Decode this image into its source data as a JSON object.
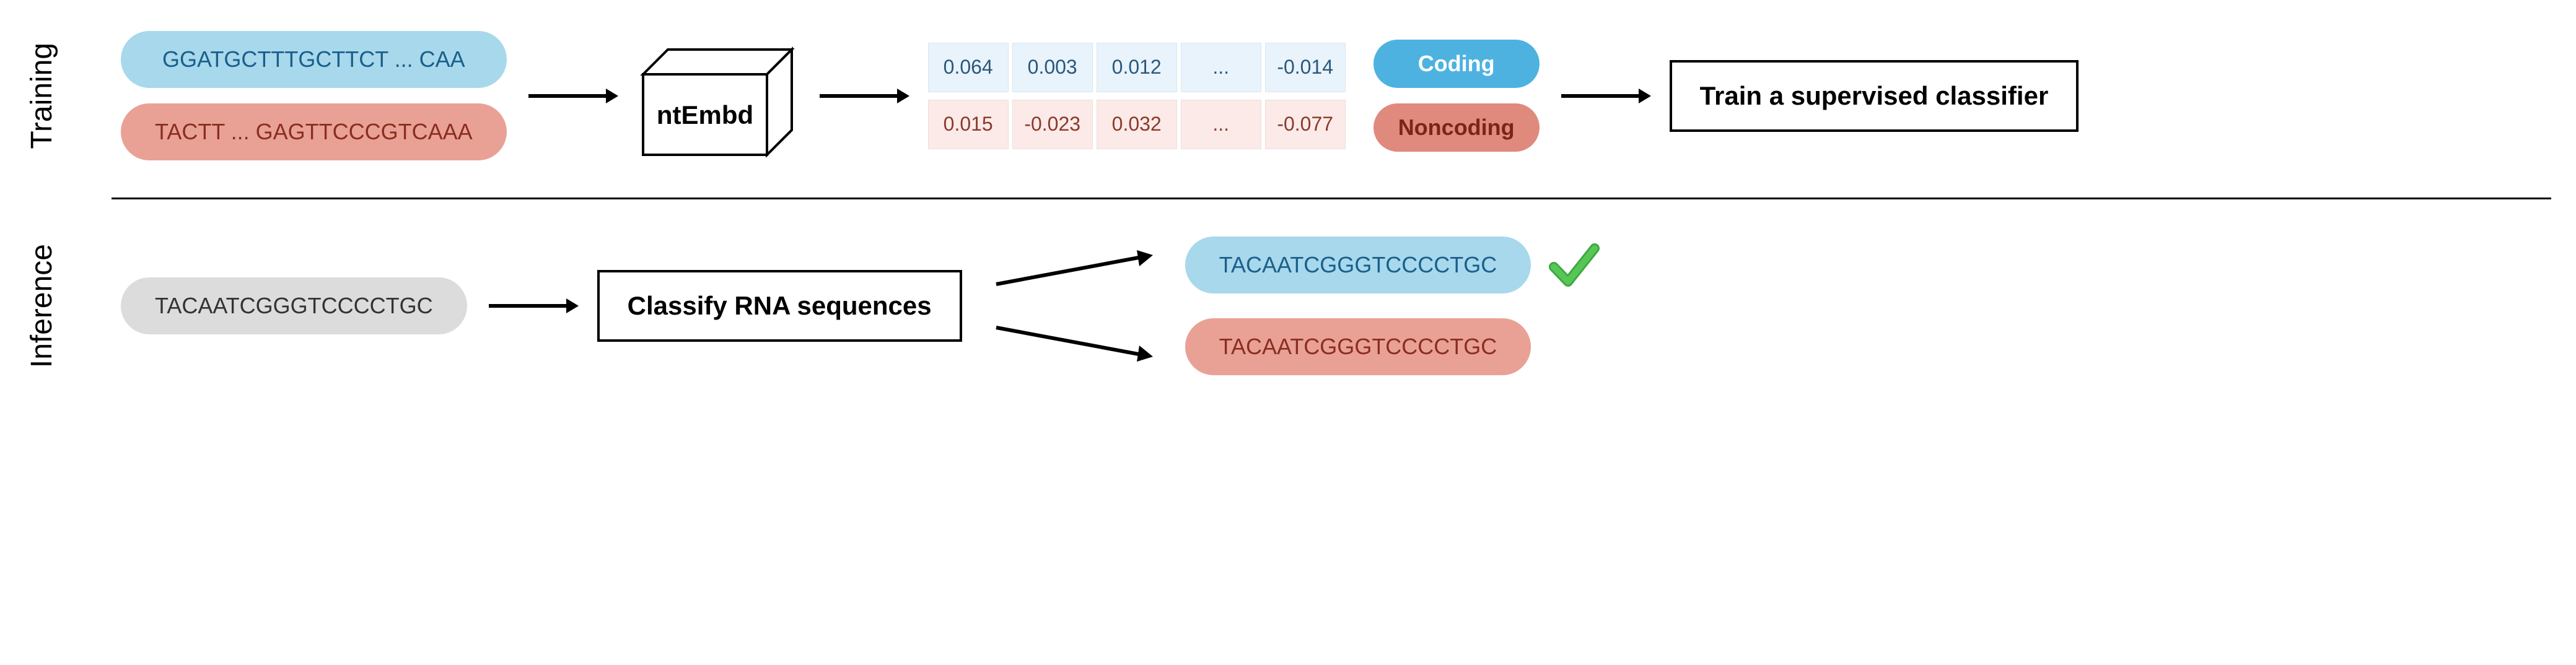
{
  "training": {
    "label": "Training",
    "seq_blue": "GGATGCTTTGCTTCT ... CAA",
    "seq_red": "TACTT ... GAGTTCCCGTCAAA",
    "model_box": "ntEmbd",
    "embeddings_blue": [
      "0.064",
      "0.003",
      "0.012",
      "...",
      "-0.014"
    ],
    "embeddings_red": [
      "0.015",
      "-0.023",
      "0.032",
      "...",
      "-0.077"
    ],
    "label_coding": "Coding",
    "label_noncoding": "Noncoding",
    "classifier_box": "Train a supervised classifier"
  },
  "inference": {
    "label": "Inference",
    "seq_in": "TACAATCGGGTCCCCTGC",
    "classify_box": "Classify RNA sequences",
    "out_blue": "TACAATCGGGTCCCCTGC",
    "out_red": "TACAATCGGGTCCCCTGC"
  }
}
